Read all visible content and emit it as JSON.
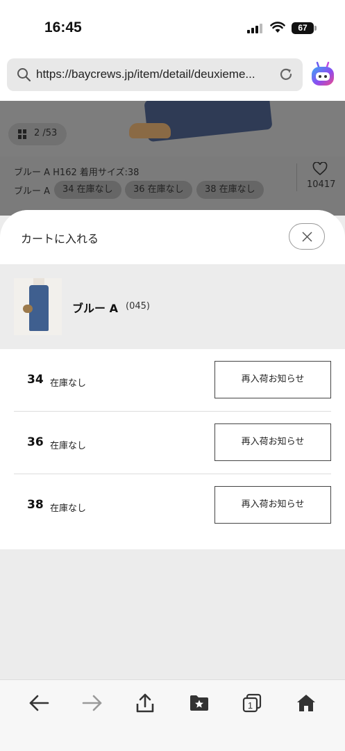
{
  "status": {
    "time": "16:45",
    "battery": "67"
  },
  "browser": {
    "url": "https://baycrews.jp/item/detail/deuxieme..."
  },
  "gallery": {
    "counter": "2 /53"
  },
  "product_info": {
    "model": "ブルー A H162 着用サイズ:38",
    "color_label": "ブルー A",
    "chips": [
      "34 在庫なし",
      "36 在庫なし",
      "38 在庫なし"
    ],
    "favorites": "10417"
  },
  "sheet": {
    "title": "カートに入れる",
    "product_name": "ブルー A",
    "product_code": "(045)",
    "sizes": [
      {
        "size": "34",
        "stock": "在庫なし",
        "button": "再入荷お知らせ"
      },
      {
        "size": "36",
        "stock": "在庫なし",
        "button": "再入荷お知らせ"
      },
      {
        "size": "38",
        "stock": "在庫なし",
        "button": "再入荷お知らせ"
      }
    ]
  },
  "toolbar": {
    "tabs_count": "1"
  }
}
